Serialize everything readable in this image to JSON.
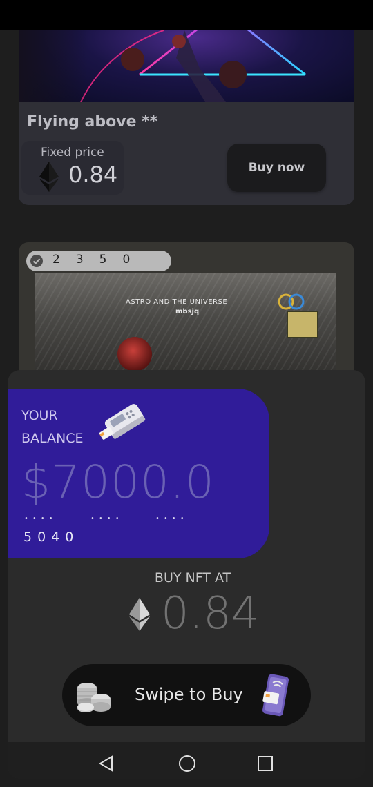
{
  "listing": {
    "title": "Flying above **",
    "price_label": "Fixed price",
    "price_value": "0.84",
    "buy_label": "Buy now"
  },
  "second_listing": {
    "likes_digits": [
      "2",
      "3",
      "5",
      "0"
    ],
    "album_title": "ASTRO AND THE UNIVERSE",
    "album_artist": "mbsjq"
  },
  "balance_card": {
    "label_line1": "YOUR",
    "label_line2": "BALANCE",
    "amount": "$7000.0",
    "masked_groups": [
      "••••",
      "••••",
      "••••"
    ],
    "card_last4": "5040"
  },
  "purchase": {
    "buy_at_label": "BUY NFT AT",
    "price": "0.84",
    "swipe_label": "Swipe to Buy"
  },
  "colors": {
    "balance_card": "#301c99",
    "sheet_bg": "#2b2b2b",
    "swipe_bg": "#111111"
  },
  "icons": [
    "ethereum-icon",
    "verified-check-icon",
    "card-reader-icon",
    "coins-icon",
    "phone-payment-icon",
    "back-icon",
    "home-icon",
    "recents-icon"
  ]
}
